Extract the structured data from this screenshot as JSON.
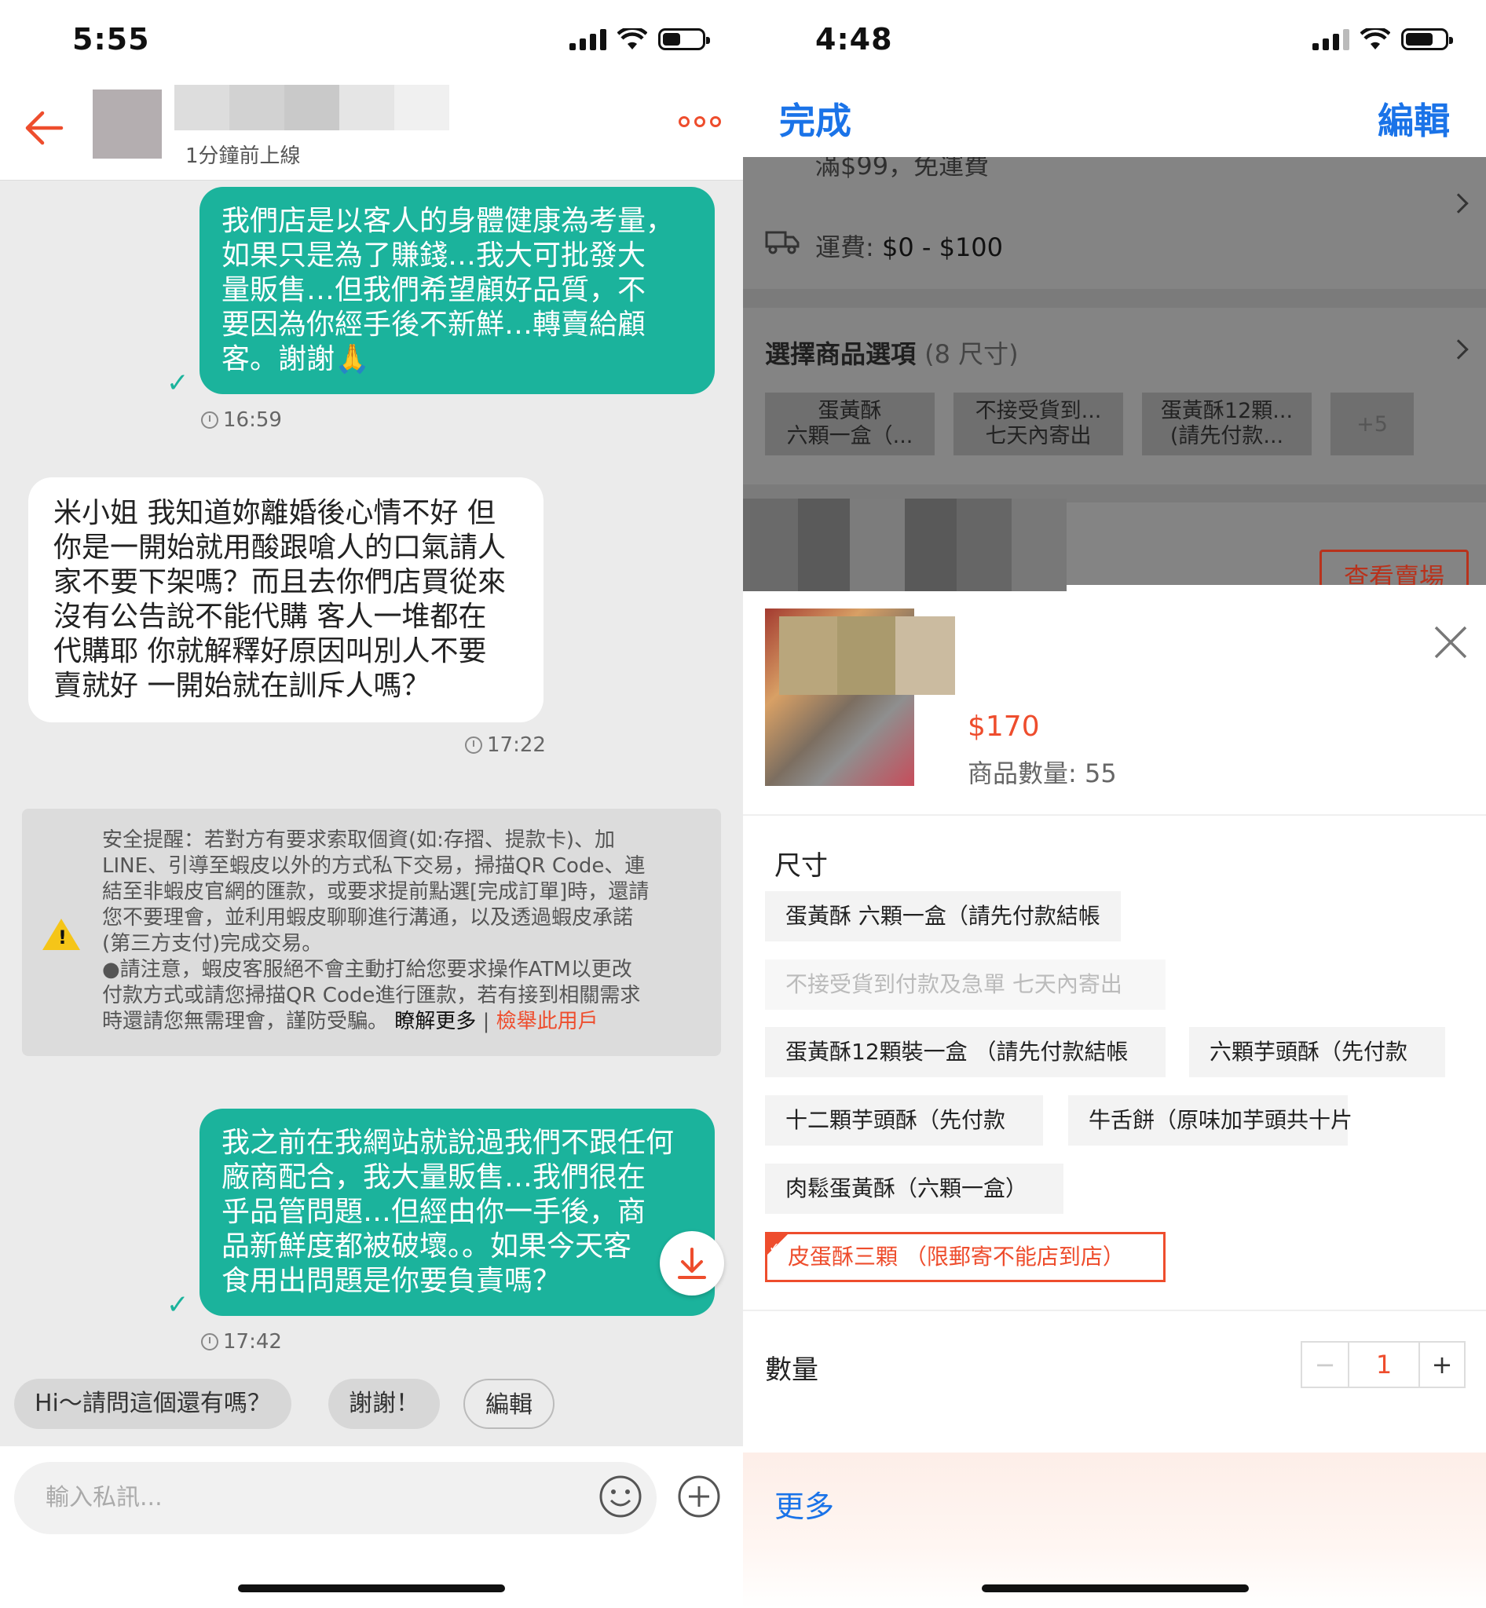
{
  "left": {
    "status_time": "5:55",
    "header": {
      "online_status": "1分鐘前上線"
    },
    "messages": [
      {
        "from": "me",
        "lines": [
          "我們店是以客人的身體健康為考量，",
          "如果只是為了賺錢…我大可批發大",
          "量販售…但我們希望顧好品質，不",
          "要因為你經手後不新鮮…轉賣給顧",
          "客。謝謝🙏"
        ],
        "time": "16:59"
      },
      {
        "from": "other",
        "lines": [
          "米小姐  我知道妳離婚後心情不好 但",
          "你是一開始就用酸跟嗆人的口氣請人",
          "家不要下架嗎？而且去你們店買從來",
          "沒有公告說不能代購  客人一堆都在",
          "代購耶   你就解釋好原因叫別人不要",
          "賣就好  一開始就在訓斥人嗎？"
        ],
        "time": "17:22"
      },
      {
        "from": "me",
        "lines": [
          "我之前在我網站就說過我們不跟任何",
          "廠商配合，我大量販售…我們很在",
          "乎品管問題…但經由你一手後，商",
          "品新鮮度都被破壞。。如果今天客",
          "食用出問題是你要負責嗎？"
        ],
        "time": "17:42"
      }
    ],
    "safety_notice": {
      "lines": [
        "安全提醒：若對方有要求索取個資(如:存摺、提款卡)、加",
        "LINE、引導至蝦皮以外的方式私下交易，掃描QR Code、連",
        "結至非蝦皮官網的匯款，或要求提前點選[完成訂單]時，還請",
        "您不要理會，並利用蝦皮聊聊進行溝通，以及透過蝦皮承諾",
        "(第三方支付)完成交易。",
        "●請注意，蝦皮客服絕不會主動打給您要求操作ATM以更改",
        "付款方式或請您掃描QR Code進行匯款，若有接到相關需求"
      ],
      "last_line": "時還請您無需理會，謹防受騙。",
      "learn_more": "瞭解更多",
      "separator": "|",
      "report": "檢舉此用戶"
    },
    "quick_replies": [
      "Hi～請問這個還有嗎？",
      "謝謝！"
    ],
    "quick_edit": "編輯",
    "input_placeholder": "輸入私訊..."
  },
  "right": {
    "status_time": "4:48",
    "done_label": "完成",
    "edit_label": "編輯",
    "background": {
      "shipping_promo": "滿$99，免運費",
      "shipping_label": "運費:",
      "shipping_value": "$0 - $100",
      "options_title": "選擇商品選項",
      "options_count": "(8 尺寸)",
      "chips": [
        [
          "蛋黃酥",
          "六顆一盒（..."
        ],
        [
          "不接受貨到...",
          "七天內寄出"
        ],
        [
          "蛋黃酥12顆...",
          "(請先付款..."
        ]
      ],
      "chip_more": "+5",
      "view_shop": "查看賣場"
    },
    "sheet": {
      "price": "$170",
      "stock": "商品數量: 55",
      "size_label": "尺寸",
      "options": [
        "蛋黃酥 六顆一盒（請先付款結帳",
        "不接受貨到付款及急單  七天內寄出",
        "蛋黃酥12顆裝一盒 （請先付款結帳",
        "六顆芋頭酥（先付款",
        "十二顆芋頭酥（先付款",
        "牛舌餅（原味加芋頭共十片",
        "肉鬆蛋黃酥（六顆一盒）",
        "皮蛋酥三顆  （限郵寄不能店到店）"
      ],
      "disabled_option_index": 1,
      "selected_option_index": 7,
      "qty_label": "數量",
      "qty_value": "1",
      "more_label": "更多"
    }
  },
  "colors": {
    "accent": "#ee4d2d",
    "bubble": "#1bb39c",
    "ios_blue": "#1a73e8"
  }
}
